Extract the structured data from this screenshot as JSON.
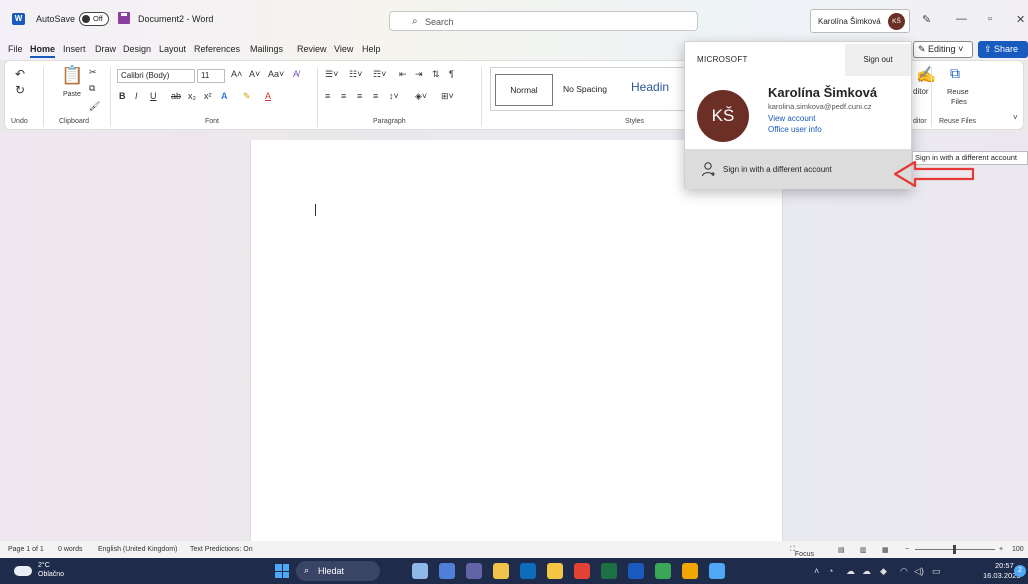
{
  "titlebar": {
    "app_logo": "W",
    "autosave_label": "AutoSave",
    "autosave_state": "Off",
    "doc_title": "Document2 - Word",
    "search_placeholder": "Search",
    "account_name": "Karolína Šimková",
    "account_initials": "KŠ",
    "icons": [
      "pen-icon",
      "minimize-icon",
      "restore-icon",
      "close-icon"
    ]
  },
  "tabs": [
    "File",
    "Home",
    "Insert",
    "Draw",
    "Design",
    "Layout",
    "References",
    "Mailings",
    "Review",
    "View",
    "Help"
  ],
  "active_tab": "Home",
  "editing_label": "Editing",
  "share_label": "Share",
  "ribbon": {
    "undo_label": "Undo",
    "paste_label": "Paste",
    "clipboard_label": "Clipboard",
    "font_name": "Calibri (Body)",
    "font_size": "11",
    "font_label": "Font",
    "paragraph_label": "Paragraph",
    "styles_label": "Styles",
    "style_normal": "Normal",
    "style_nospacing": "No Spacing",
    "style_heading": "Headin",
    "editor_label": "ditor",
    "editor_group_label": "ditor",
    "reuse_files_line1": "Reuse",
    "reuse_files_line2": "Files",
    "reuse_files_group": "Reuse Files",
    "font_buttons": [
      "B",
      "I",
      "U",
      "ab",
      "x₂",
      "x²",
      "A",
      "A",
      "Aa",
      "A˄",
      "A˅"
    ]
  },
  "popup": {
    "header": "MICROSOFT",
    "sign_out": "Sign out",
    "initials": "KŠ",
    "name": "Karolína Šimková",
    "email": "karolina.simkova@pedf.cuni.cz",
    "view_account": "View account",
    "office_user_info": "Office user info",
    "different_account": "Sign in with a different account"
  },
  "tooltip": "Sign in with a different account",
  "statusbar": {
    "page": "Page 1 of 1",
    "words": "0 words",
    "language": "English (United Kingdom)",
    "predictions": "Text Predictions: On",
    "focus": "Focus",
    "zoom": "100"
  },
  "taskbar": {
    "temp": "2°C",
    "condition": "Oblačno",
    "search_label": "Hledat",
    "time": "20:57",
    "date": "16.03.2023",
    "notification_count": "2",
    "apps": [
      {
        "name": "widgets-app-icon",
        "color": "#8fb6e8"
      },
      {
        "name": "files-app-icon",
        "color": "#4f7fd8"
      },
      {
        "name": "chat-app-icon",
        "color": "#6264a7"
      },
      {
        "name": "store-app-icon",
        "color": "#f0c14b"
      },
      {
        "name": "outlook-app-icon",
        "color": "#0f6cbd"
      },
      {
        "name": "explorer-app-icon",
        "color": "#f4c542"
      },
      {
        "name": "chrome-app-icon",
        "color": "#e34133"
      },
      {
        "name": "excel-app-icon",
        "color": "#1d7044"
      },
      {
        "name": "word-app-icon",
        "color": "#185abd"
      },
      {
        "name": "chrome2-app-icon",
        "color": "#3aa757"
      },
      {
        "name": "chrome3-app-icon",
        "color": "#f2a600"
      },
      {
        "name": "other-app-icon",
        "color": "#4fa8f6"
      }
    ]
  },
  "colors": {
    "accent": "#185abd",
    "avatar": "#6b2f25",
    "arrow": "#e53935"
  }
}
